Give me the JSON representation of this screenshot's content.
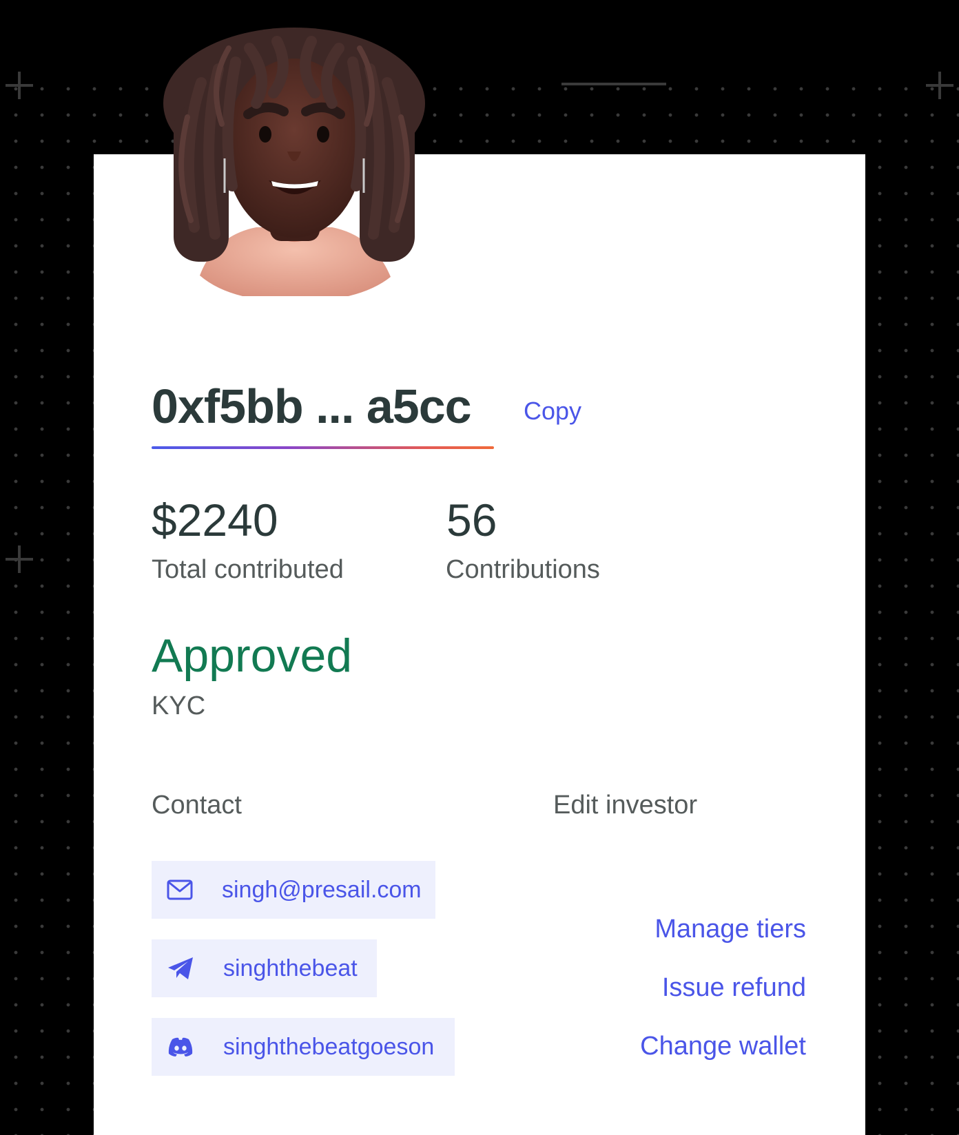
{
  "profile": {
    "address": "0xf5bb ... a5cc",
    "copy_label": "Copy"
  },
  "stats": {
    "total_value": "$2240",
    "total_label": "Total contributed",
    "count_value": "56",
    "count_label": "Contributions"
  },
  "kyc": {
    "status": "Approved",
    "label": "KYC"
  },
  "contact": {
    "heading": "Contact",
    "items": [
      {
        "icon": "mail-icon",
        "label": "singh@presail.com"
      },
      {
        "icon": "telegram-icon",
        "label": "singhthebeat"
      },
      {
        "icon": "discord-icon",
        "label": "singhthebeatgoeson"
      }
    ]
  },
  "edit": {
    "heading": "Edit investor",
    "actions": [
      "Manage tiers",
      "Issue refund",
      "Change wallet"
    ]
  },
  "colors": {
    "accent": "#4a55e8",
    "approved": "#127a52",
    "chip_bg": "#eef0fd",
    "text_dark": "#2b3a3a",
    "text_muted": "#555b5b",
    "background": "#000000"
  }
}
